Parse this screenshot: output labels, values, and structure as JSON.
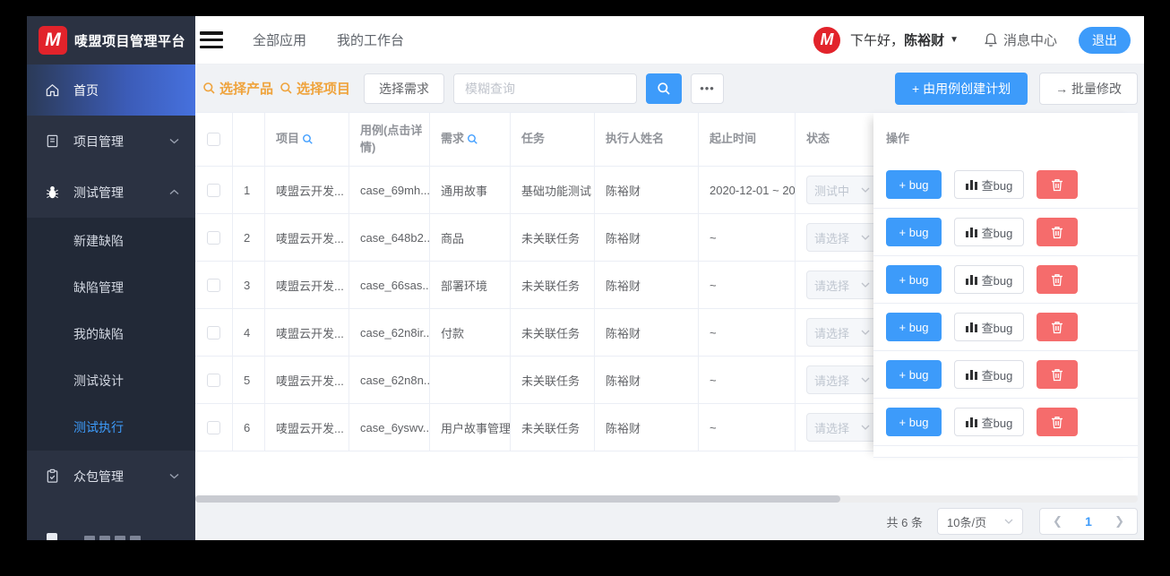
{
  "sidebar": {
    "logo": {
      "letter": "M",
      "title": "唛盟项目管理平台"
    },
    "items": [
      {
        "label": "首页"
      },
      {
        "label": "项目管理"
      },
      {
        "label": "测试管理",
        "children": [
          "新建缺陷",
          "缺陷管理",
          "我的缺陷",
          "测试设计",
          "测试执行"
        ]
      },
      {
        "label": "众包管理"
      }
    ],
    "active_item": "首页",
    "active_child": "测试执行"
  },
  "header": {
    "tabs": [
      "全部应用",
      "我的工作台"
    ],
    "avatar_letter": "M",
    "greeting": "下午好，",
    "username": "陈裕财",
    "caret": "▼",
    "message_center": "消息中心",
    "logout": "退出"
  },
  "toolbar": {
    "select_product": "选择产品",
    "select_project": "选择项目",
    "select_requirement": "选择需求",
    "search_placeholder": "模糊查询",
    "more": "•••",
    "create_plan": "+ 由用例创建计划",
    "batch_edit": "→ 批量修改"
  },
  "table": {
    "headers": {
      "project": "项目",
      "case": "用例(点击详情)",
      "requirement": "需求",
      "task": "任务",
      "executor": "执行人姓名",
      "dates": "起止时间",
      "status": "状态",
      "actions": "操作"
    },
    "rows": [
      {
        "index": "1",
        "project": "唛盟云开发...",
        "case": "case_69mh...",
        "requirement": "通用故事",
        "task": "基础功能测试",
        "executor": "陈裕财",
        "dates": "2020-12-01 ~ 20",
        "status": "测试中"
      },
      {
        "index": "2",
        "project": "唛盟云开发...",
        "case": "case_648b2...",
        "requirement": "商品",
        "task": "未关联任务",
        "executor": "陈裕财",
        "dates": "~",
        "status": "请选择"
      },
      {
        "index": "3",
        "project": "唛盟云开发...",
        "case": "case_66sas...",
        "requirement": "部署环境",
        "task": "未关联任务",
        "executor": "陈裕财",
        "dates": "~",
        "status": "请选择"
      },
      {
        "index": "4",
        "project": "唛盟云开发...",
        "case": "case_62n8ir...",
        "requirement": "付款",
        "task": "未关联任务",
        "executor": "陈裕财",
        "dates": "~",
        "status": "请选择"
      },
      {
        "index": "5",
        "project": "唛盟云开发...",
        "case": "case_62n8n...",
        "requirement": "",
        "task": "未关联任务",
        "executor": "陈裕财",
        "dates": "~",
        "status": "请选择"
      },
      {
        "index": "6",
        "project": "唛盟云开发...",
        "case": "case_6yswv...",
        "requirement": "用户故事管理",
        "task": "未关联任务",
        "executor": "陈裕财",
        "dates": "~",
        "status": "请选择"
      }
    ],
    "actions": {
      "add_bug": "+ bug",
      "view_bug": "查bug"
    }
  },
  "footer": {
    "total": "共 6 条",
    "page_size": "10条/页",
    "page": "1"
  },
  "colors": {
    "accent": "#3d9bfa",
    "danger": "#f56c6c",
    "logo_red": "#e2232b",
    "link_orange": "#efa33c",
    "sidebar": "#2b3242"
  }
}
